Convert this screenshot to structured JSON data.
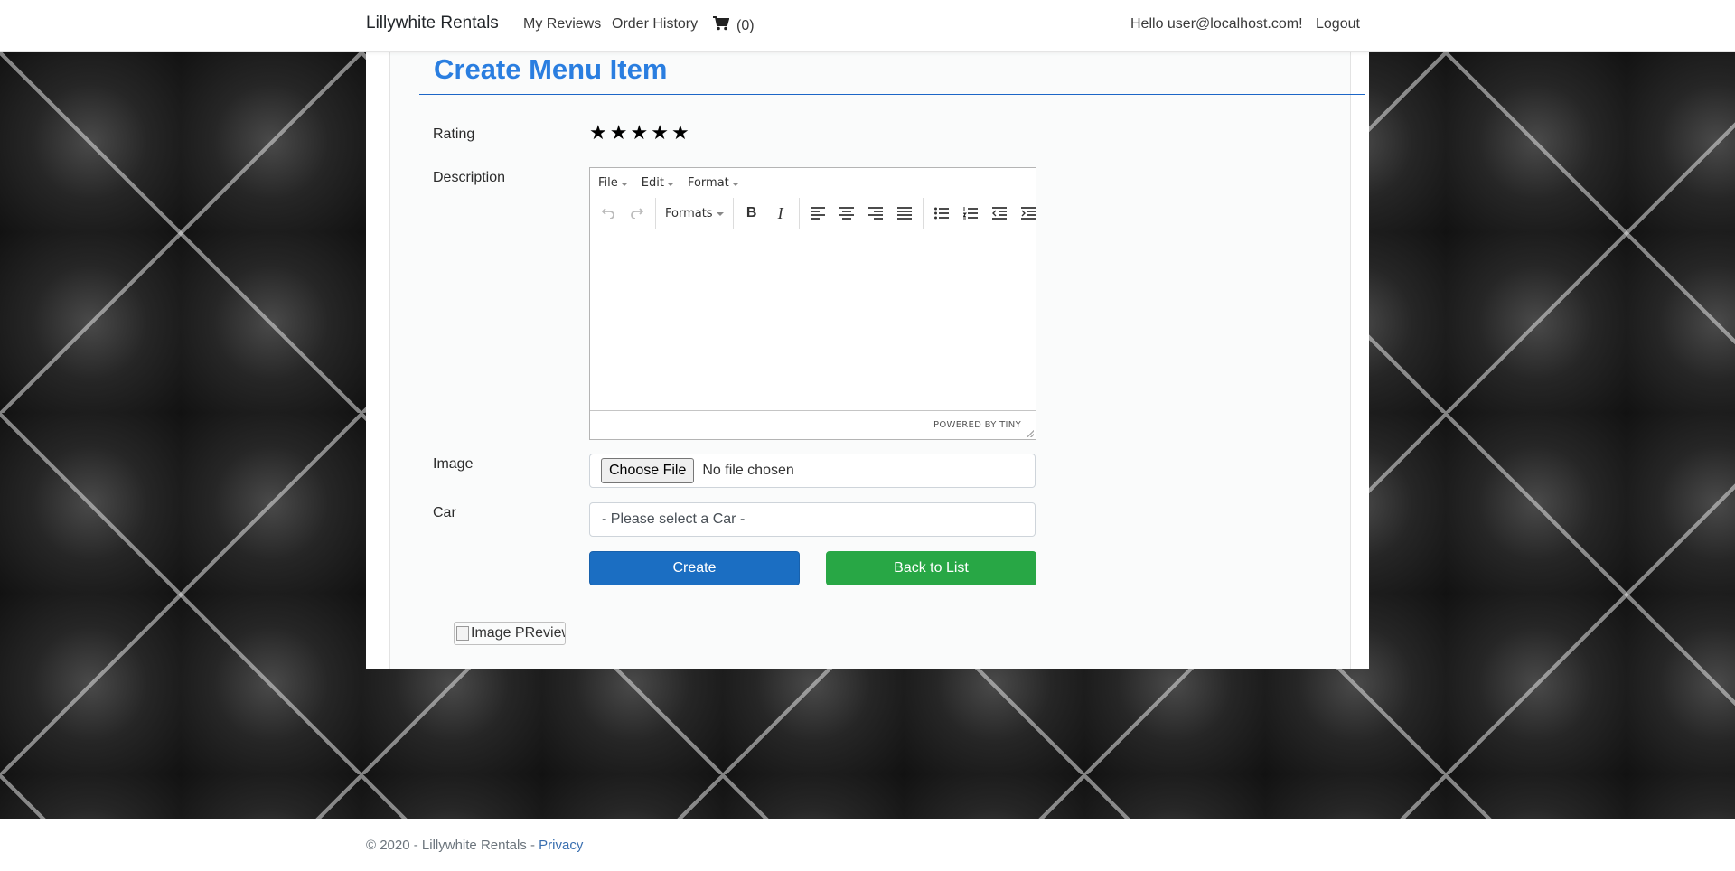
{
  "navbar": {
    "brand": "Lillywhite Rentals",
    "links": {
      "my_reviews": "My Reviews",
      "order_history": "Order History",
      "cart_count": "(0)"
    },
    "greeting": "Hello user@localhost.com!",
    "logout": "Logout"
  },
  "form": {
    "title": "Create Menu Item",
    "rating": {
      "label": "Rating",
      "value": 5,
      "max": 5
    },
    "description": {
      "label": "Description",
      "menubar": [
        "File",
        "Edit",
        "Format"
      ],
      "toolbar": {
        "formats_label": "Formats",
        "icons": [
          "undo-icon",
          "redo-icon",
          "bold-icon",
          "italic-icon",
          "align-left-icon",
          "align-center-icon",
          "align-right-icon",
          "align-justify-icon",
          "bullet-list-icon",
          "numbered-list-icon",
          "outdent-icon",
          "indent-icon"
        ]
      },
      "content": "",
      "statusbar": "POWERED BY TINY"
    },
    "image": {
      "label": "Image",
      "button": "Choose File",
      "status": "No file chosen"
    },
    "car": {
      "label": "Car",
      "selected": "- Please select a Car -"
    },
    "buttons": {
      "create": "Create",
      "back": "Back to List"
    },
    "image_preview_alt": "Image PReview"
  },
  "footer": {
    "copyright": "© 2020 - Lillywhite Rentals -",
    "privacy": "Privacy"
  },
  "colors": {
    "title": "#2a7ee0",
    "create_button": "#1b6ec2",
    "back_button": "#28a745"
  }
}
